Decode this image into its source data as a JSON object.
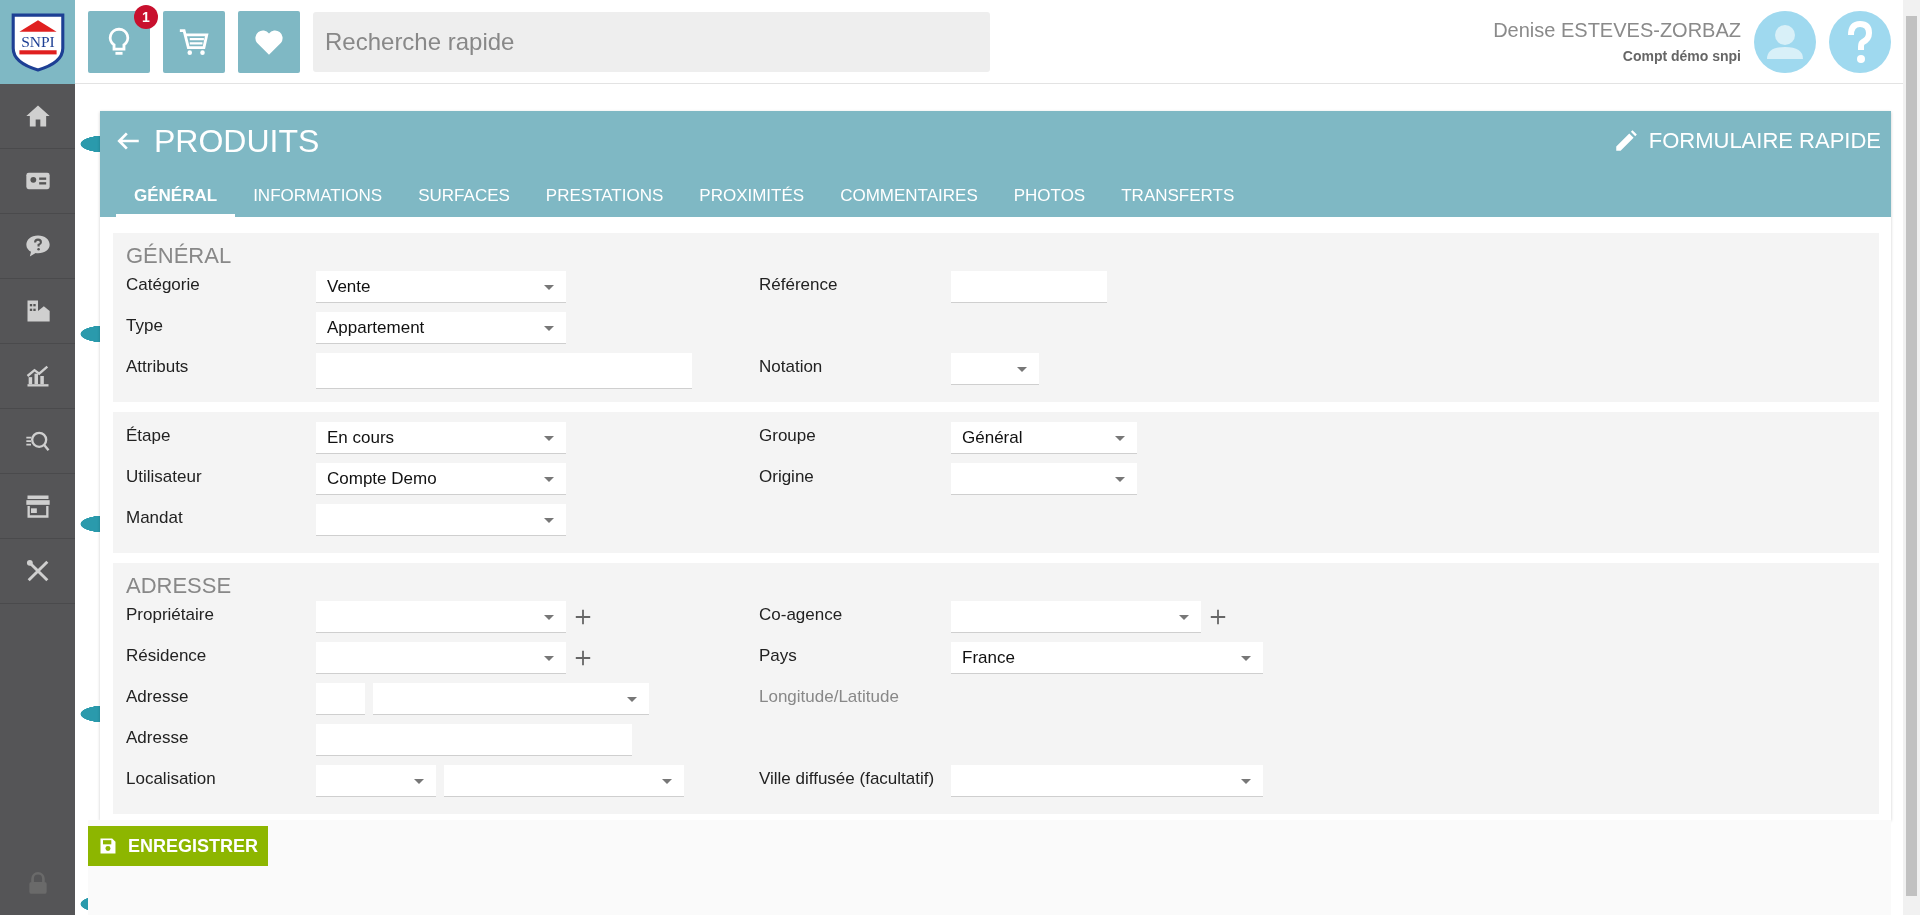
{
  "logo": {
    "text": "SNPI"
  },
  "toolbar": {
    "notification_badge": "1",
    "search": {
      "placeholder": "Recherche rapide"
    }
  },
  "user": {
    "name": "Denise ESTEVES-ZORBAZ",
    "account": "Compt démo snpi"
  },
  "page": {
    "title": "PRODUITS",
    "action": "FORMULAIRE RAPIDE",
    "tabs": [
      {
        "label": "GÉNÉRAL",
        "selected": true
      },
      {
        "label": "INFORMATIONS",
        "selected": false
      },
      {
        "label": "SURFACES",
        "selected": false
      },
      {
        "label": "PRESTATIONS",
        "selected": false
      },
      {
        "label": "PROXIMITÉS",
        "selected": false
      },
      {
        "label": "COMMENTAIRES",
        "selected": false
      },
      {
        "label": "PHOTOS",
        "selected": false
      },
      {
        "label": "TRANSFERTS",
        "selected": false
      }
    ]
  },
  "sections": [
    {
      "heading": "GÉNÉRAL",
      "rows": [
        {
          "left": {
            "label": "Catégorie",
            "kind": "select",
            "value": "Vente"
          },
          "right": {
            "label": "Référence",
            "kind": "input-short"
          }
        },
        {
          "left": {
            "label": "Type",
            "kind": "select",
            "value": "Appartement"
          }
        },
        {
          "left": {
            "label": "Attributs",
            "kind": "input-wide"
          },
          "right": {
            "label": "Notation",
            "kind": "select-tiny"
          }
        }
      ]
    },
    {
      "rows": [
        {
          "left": {
            "label": "Étape",
            "kind": "select",
            "value": "En cours"
          },
          "right": {
            "label": "Groupe",
            "kind": "select-medium",
            "value": "Général"
          }
        },
        {
          "left": {
            "label": "Utilisateur",
            "kind": "select",
            "value": "Compte Demo"
          },
          "right": {
            "label": "Origine",
            "kind": "select-medium"
          }
        },
        {
          "left": {
            "label": "Mandat",
            "kind": "select"
          }
        }
      ]
    },
    {
      "heading": "ADRESSE",
      "rows": [
        {
          "left": {
            "label": "Propriétaire",
            "kind": "select",
            "addable": true
          },
          "right": {
            "label": "Co-agence",
            "kind": "select",
            "addable": true
          }
        },
        {
          "left": {
            "label": "Résidence",
            "kind": "select",
            "addable": true
          },
          "right": {
            "label": "Pays",
            "kind": "select-wide",
            "value": "France"
          }
        },
        {
          "left": {
            "label": "Adresse",
            "kind": "address-pair"
          },
          "right": {
            "label": "Longitude/Latitude",
            "kind": "label-only"
          }
        },
        {
          "left": {
            "label": "Adresse",
            "kind": "input-medium"
          }
        },
        {
          "left": {
            "label": "Localisation",
            "kind": "select-pair"
          },
          "right": {
            "label": "Ville diffusée (facultatif)",
            "kind": "select-wide"
          }
        }
      ]
    }
  ],
  "save_button": "ENREGISTRER"
}
